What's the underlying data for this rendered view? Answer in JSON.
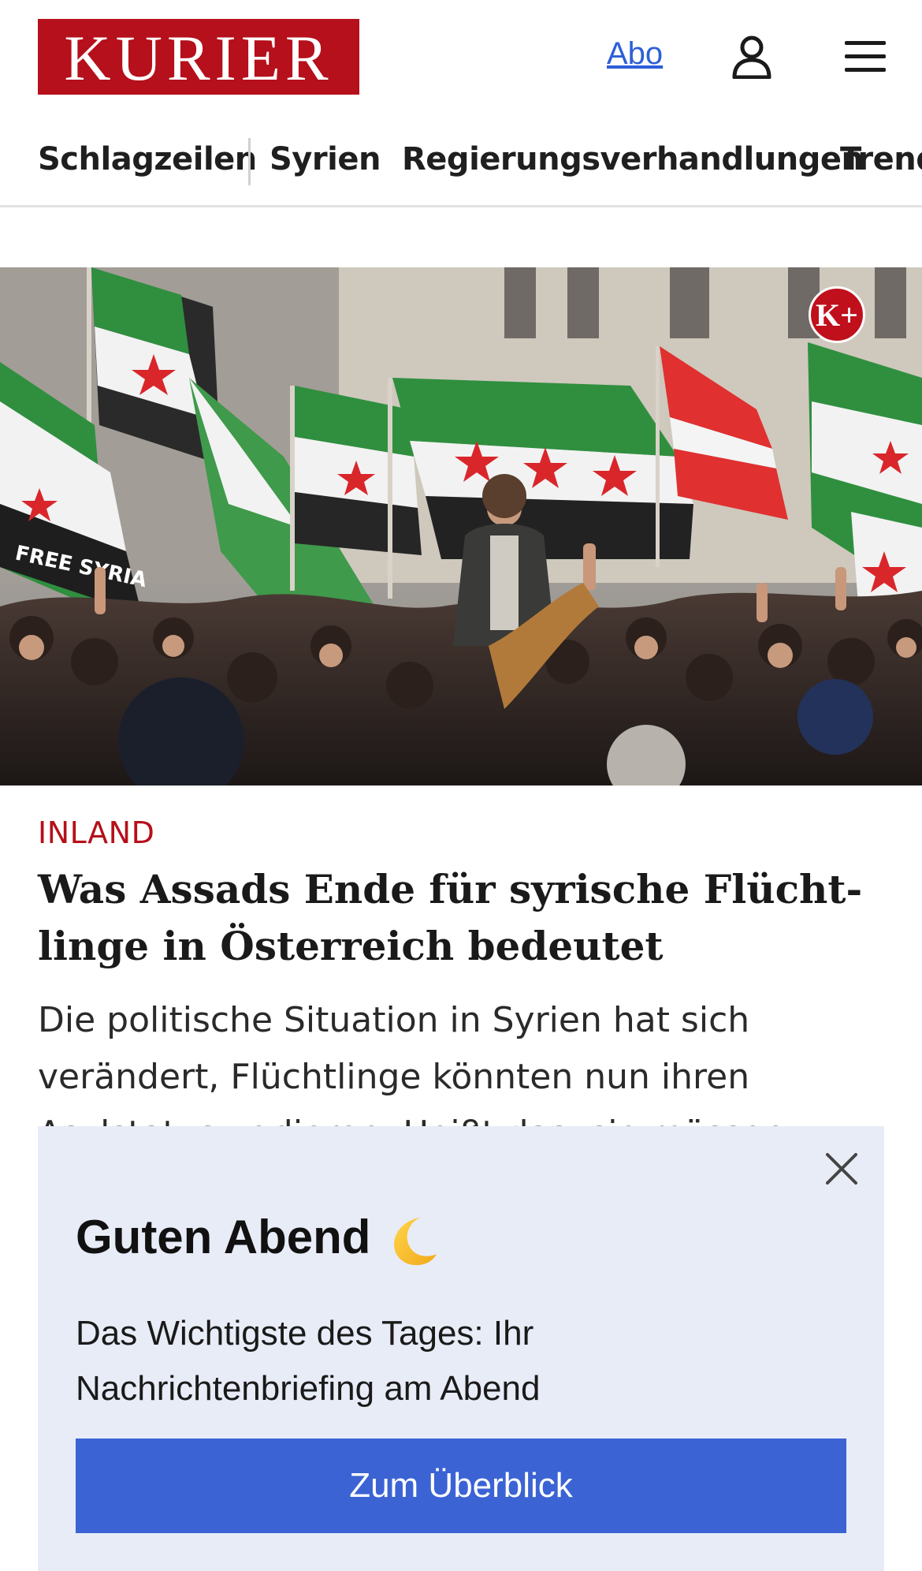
{
  "header": {
    "logo_text": "KURIER",
    "abo_link": "Abo",
    "icons": {
      "user": "user-icon",
      "menu": "hamburger-menu-icon"
    }
  },
  "nav": {
    "items": [
      {
        "label": "Schlagzeilen"
      },
      {
        "label": "Syrien"
      },
      {
        "label": "Regierungsverhandlungen"
      },
      {
        "label": "Trend"
      }
    ]
  },
  "hero": {
    "badge": "K+"
  },
  "article": {
    "category": "INLAND",
    "headline_line1": "Was Assads Ende für syrische Flücht-",
    "headline_line2": "linge in Österreich bedeutet",
    "teaser_line1": "Die politische Situation in Syrien hat sich",
    "teaser_line2": "verändert, Flüchtlinge könnten nun ihren",
    "teaser_line3": "Asylstatus verlieren. Heißt das, sie müssen"
  },
  "popup": {
    "title": "Guten Abend",
    "title_icon": "crescent-moon-icon",
    "text_line1": "Das Wichtigste des Tages: Ihr",
    "text_line2": "Nachrichtenbriefing am Abend",
    "button_label": "Zum Überblick"
  },
  "colors": {
    "brand_red": "#b5101b",
    "link_blue": "#2d5fd8",
    "button_blue": "#3b63d4",
    "popup_bg": "#e8ecf7"
  }
}
